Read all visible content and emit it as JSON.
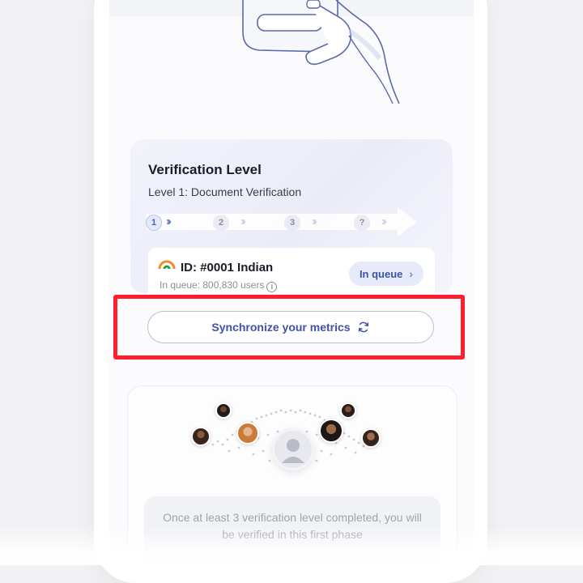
{
  "verification": {
    "title": "Verification Level",
    "subtitle": "Level 1: Document Verification",
    "steps": [
      "1",
      "2",
      "3",
      "?"
    ],
    "active_step": 1
  },
  "queue_card": {
    "id_text": "ID: #0001 Indian",
    "queue_text": "In queue: 800,830 users",
    "info_icon": "i",
    "status_label": "In queue",
    "chevron": "›"
  },
  "sync": {
    "label": "Synchronize your metrics",
    "icon": "refresh-icon"
  },
  "community": {
    "message": "Once at least 3 verification level completed, you will be verified in this first phase"
  },
  "colors": {
    "accent": "#4250a6",
    "highlight": "#ff1e2b",
    "pill_bg": "#e6eaf9"
  }
}
